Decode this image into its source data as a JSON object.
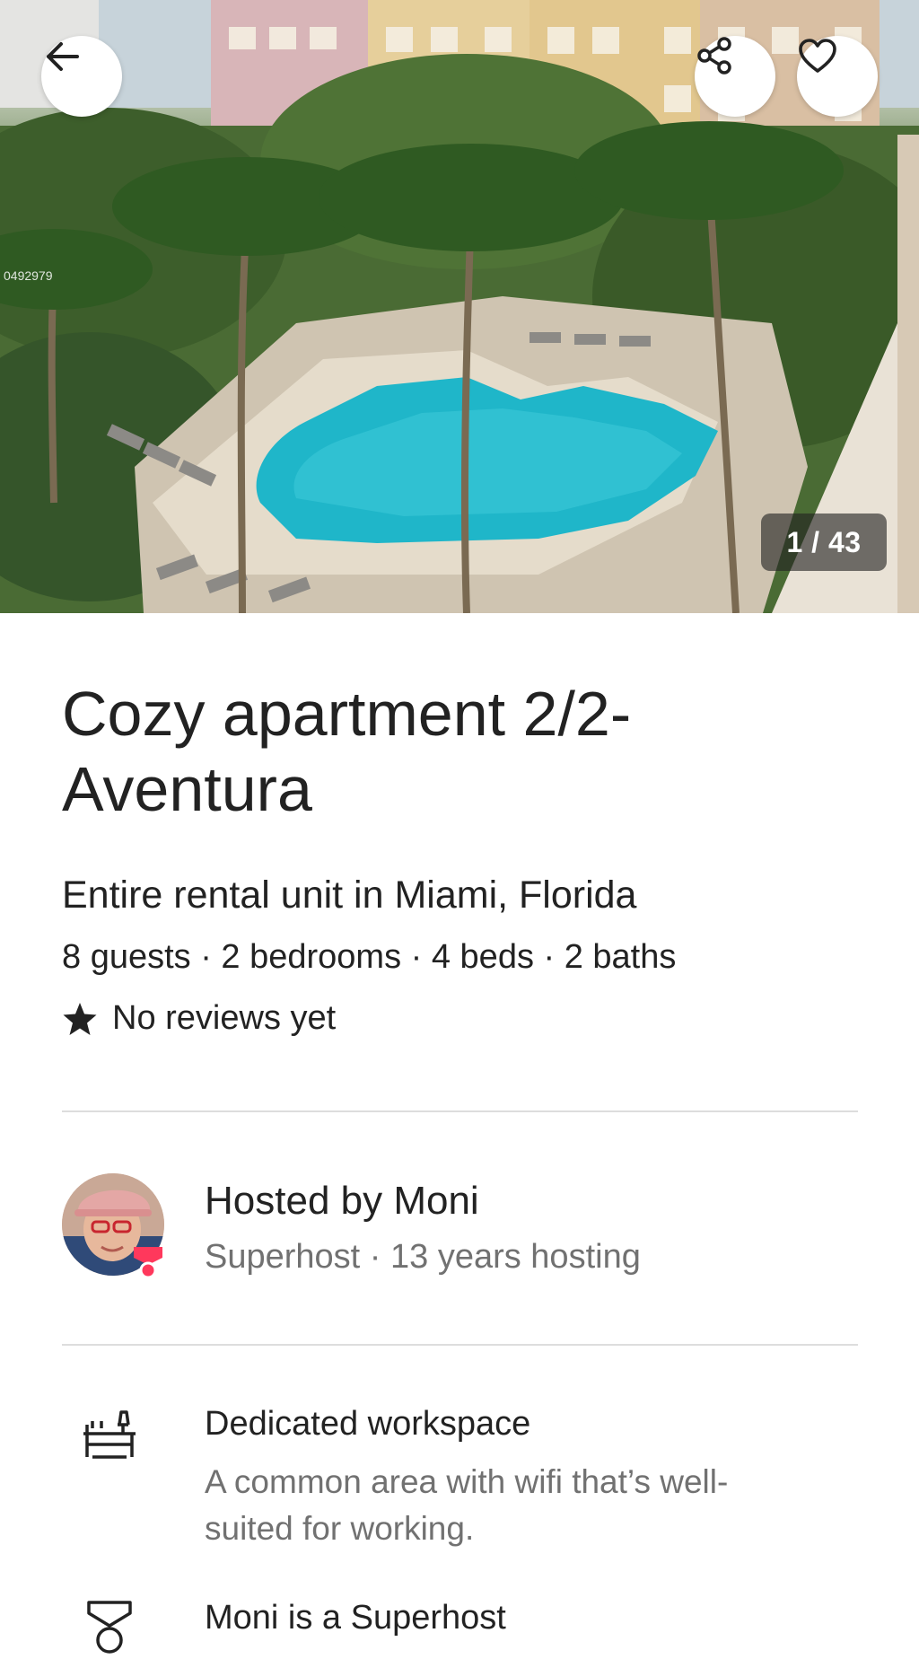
{
  "hero": {
    "photo_counter": "1 / 43",
    "watermark": "0492979",
    "icons": {
      "back": "arrow-left-icon",
      "share": "share-icon",
      "favorite": "heart-icon"
    }
  },
  "listing": {
    "title": "Cozy apartment 2/2-Aventura",
    "subtitle": "Entire rental unit in Miami, Florida",
    "details": "8 guests · 2 bedrooms · 4 beds · 2 baths",
    "reviews": "No reviews yet"
  },
  "host": {
    "title": "Hosted by Moni",
    "subtitle": "Superhost · 13 years hosting"
  },
  "features": [
    {
      "icon": "desk-icon",
      "title": "Dedicated workspace",
      "description": "A common area with wifi that’s well-suited for working."
    },
    {
      "icon": "superhost-medal-icon",
      "title": "Moni is a Superhost",
      "description": ""
    }
  ],
  "colors": {
    "text_primary": "#222222",
    "text_secondary": "#717171",
    "divider": "#dddddd",
    "brand": "#ff385c",
    "pool": "#1fb6c9"
  }
}
